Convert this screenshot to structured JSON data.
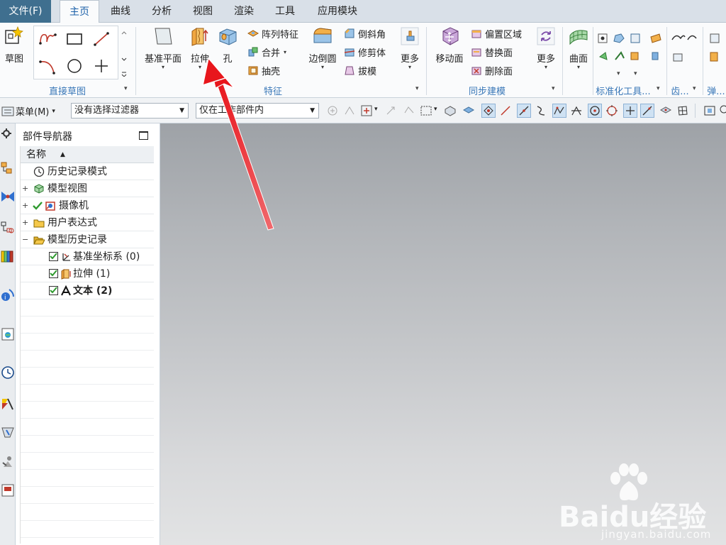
{
  "menubar": {
    "file": "文件(F)",
    "tabs": [
      "主页",
      "曲线",
      "分析",
      "视图",
      "渲染",
      "工具",
      "应用模块"
    ],
    "active_index": 0
  },
  "ribbon": {
    "sketch": {
      "label": "草图",
      "group": "直接草图"
    },
    "feature": {
      "datum_plane": "基准平面",
      "extrude": "拉伸",
      "hole": "孔",
      "pattern": "阵列特征",
      "unite": "合并",
      "shell": "抽壳",
      "edge_blend": "边倒圆",
      "chamfer": "倒斜角",
      "trim_body": "修剪体",
      "draft": "拔模",
      "more": "更多",
      "group": "特征"
    },
    "sync": {
      "move_face": "移动面",
      "offset_region": "偏置区域",
      "replace_face": "替换面",
      "delete_face": "删除面",
      "more": "更多",
      "group": "同步建模"
    },
    "surface": {
      "label": "曲面"
    },
    "standard": {
      "group": "标准化工具..."
    },
    "gear": {
      "group": "齿..."
    },
    "spring": {
      "group": "弹..."
    }
  },
  "toolbar": {
    "menu_label": "菜单(M)",
    "filter": "没有选择过滤器",
    "scope": "仅在工作部件内"
  },
  "navigator": {
    "title": "部件导航器",
    "column": "名称",
    "items": [
      {
        "label": "历史记录模式"
      },
      {
        "label": "模型视图"
      },
      {
        "label": "摄像机"
      },
      {
        "label": "用户表达式"
      },
      {
        "label": "模型历史记录"
      },
      {
        "label": "基准坐标系 (0)"
      },
      {
        "label": "拉伸 (1)"
      },
      {
        "label": "文本 (2)"
      }
    ]
  },
  "watermark": {
    "brand": "Baidu经验",
    "url": "jingyan.baidu.com"
  },
  "colors": {
    "accent": "#3f6f8f",
    "group_label": "#3a78b8",
    "annotation_arrow": "#e8161c"
  }
}
